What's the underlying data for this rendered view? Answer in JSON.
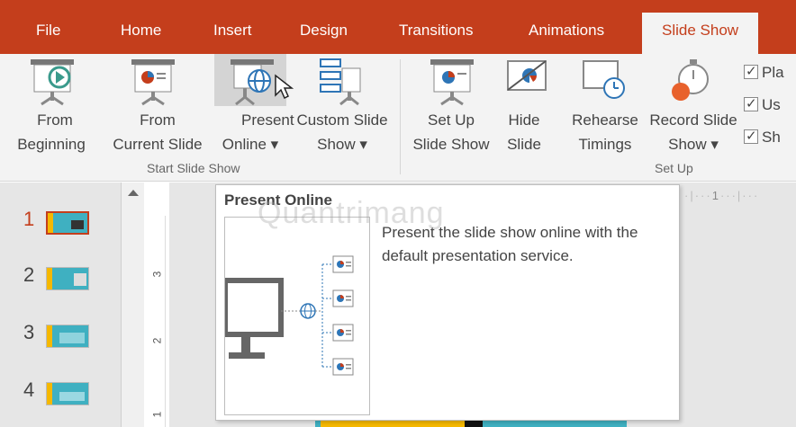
{
  "tabs": [
    "File",
    "Home",
    "Insert",
    "Design",
    "Transitions",
    "Animations",
    "Slide Show"
  ],
  "active_tab": "Slide Show",
  "ribbon": {
    "from_beginning": [
      "From",
      "Beginning"
    ],
    "from_current": [
      "From",
      "Current Slide"
    ],
    "present_online": [
      "Present",
      "Online ▾"
    ],
    "custom_show": [
      "Custom Slide",
      "Show ▾"
    ],
    "setup_show": [
      "Set Up",
      "Slide Show"
    ],
    "hide_slide": [
      "Hide",
      "Slide"
    ],
    "rehearse": [
      "Rehearse",
      "Timings"
    ],
    "record": [
      "Record Slide",
      "Show ▾"
    ],
    "group_start": "Start Slide Show",
    "group_setup": "Set Up",
    "checkboxes": [
      "Pla",
      "Us",
      "Sh"
    ]
  },
  "slides": [
    "1",
    "2",
    "3",
    "4"
  ],
  "current_slide": "1",
  "vruler": [
    "3",
    "2",
    "1"
  ],
  "hruler": "1",
  "tooltip": {
    "title": "Present Online",
    "description": "Present the slide show online with the default presentation service."
  },
  "watermark": "Quantrimang",
  "colors": {
    "accent": "#c43e1c",
    "ribbon_bg": "#f3f3f3",
    "slide_bg": "#3fb0c1"
  }
}
